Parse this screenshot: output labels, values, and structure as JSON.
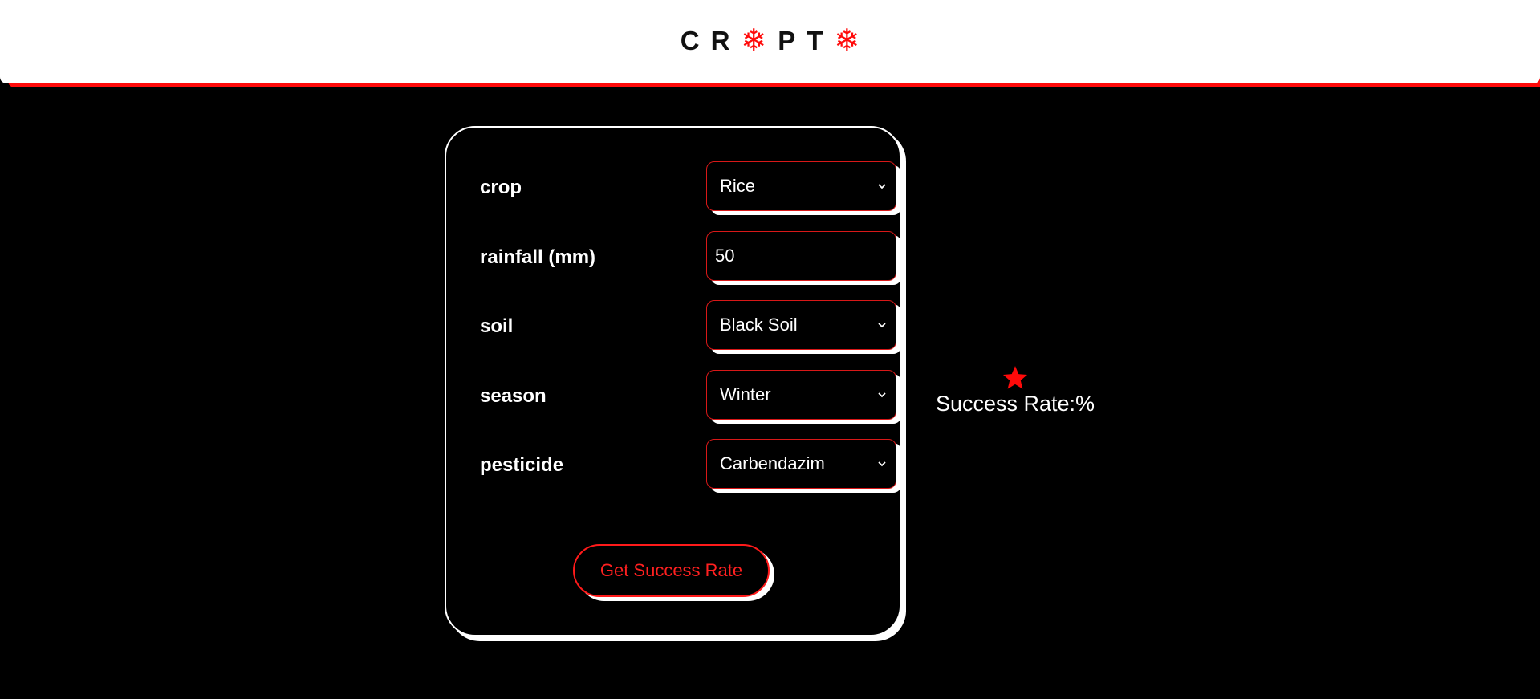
{
  "header": {
    "logo_letters": [
      "C",
      "R",
      "P",
      "T"
    ],
    "accent_color": "#ff0a0a"
  },
  "form": {
    "fields": [
      {
        "label": "crop",
        "value": "Rice",
        "type": "select"
      },
      {
        "label": "rainfall (mm)",
        "value": "50",
        "type": "input"
      },
      {
        "label": "soil",
        "value": "Black Soil",
        "type": "select"
      },
      {
        "label": "season",
        "value": "Winter",
        "type": "select"
      },
      {
        "label": "pesticide",
        "value": "Carbendazim",
        "type": "select"
      }
    ],
    "submit_label": "Get Success Rate"
  },
  "result": {
    "icon": "star-icon",
    "text": "Success Rate:%"
  }
}
